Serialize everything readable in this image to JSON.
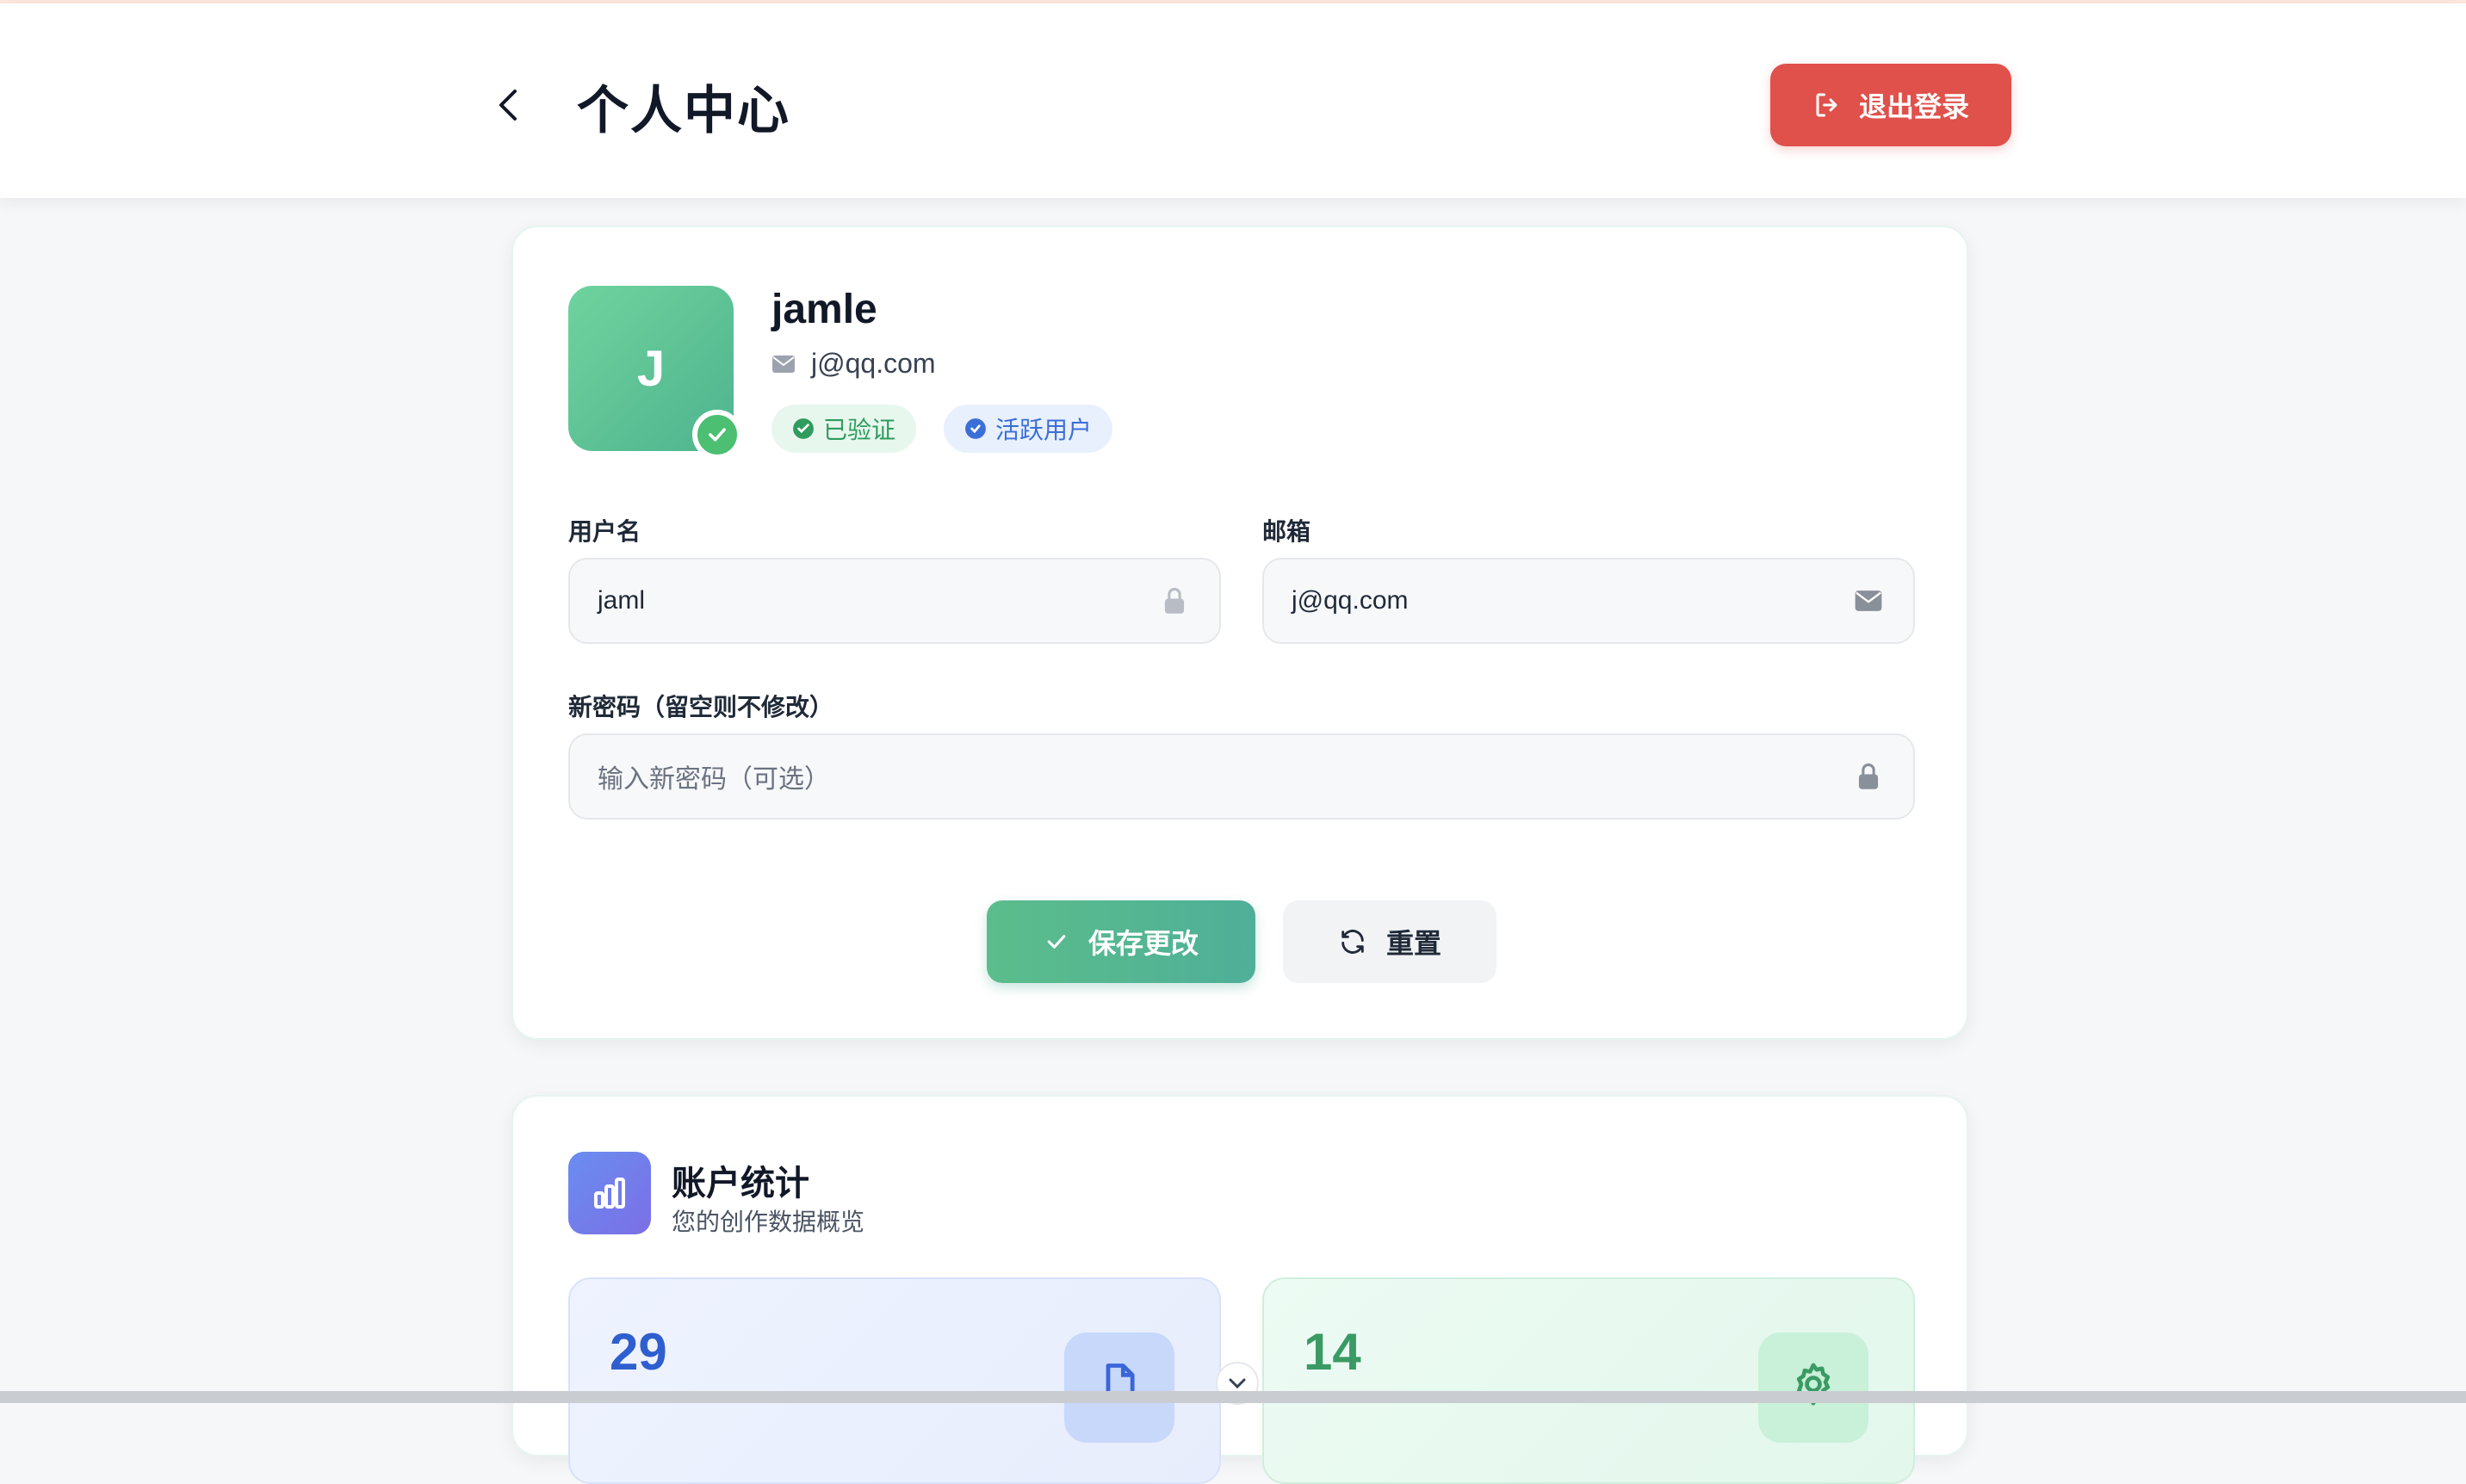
{
  "header": {
    "title": "个人中心",
    "logout_label": "退出登录",
    "logout_color": "#e0514b"
  },
  "profile": {
    "avatar_letter": "J",
    "username": "jamle",
    "email": "j@qq.com",
    "badges": [
      {
        "label": "已验证",
        "color": "#2f9c5d"
      },
      {
        "label": "活跃用户",
        "color": "#3a6ed8"
      }
    ]
  },
  "form": {
    "username_label": "用户名",
    "username_value": "jaml",
    "email_label": "邮箱",
    "email_value": "j@qq.com",
    "password_label": "新密码（留空则不修改）",
    "password_placeholder": "输入新密码（可选）",
    "save_label": "保存更改",
    "reset_label": "重置"
  },
  "stats": {
    "title": "账户统计",
    "subtitle": "您的创作数据概览",
    "items": [
      {
        "value": "29",
        "icon": "document-icon",
        "color": "#2f5fcf"
      },
      {
        "value": "14",
        "icon": "gear-icon",
        "color": "#3a9a64"
      }
    ]
  },
  "colors": {
    "accent_green": "#4faf98",
    "brand_blue": "#6a8df0"
  }
}
